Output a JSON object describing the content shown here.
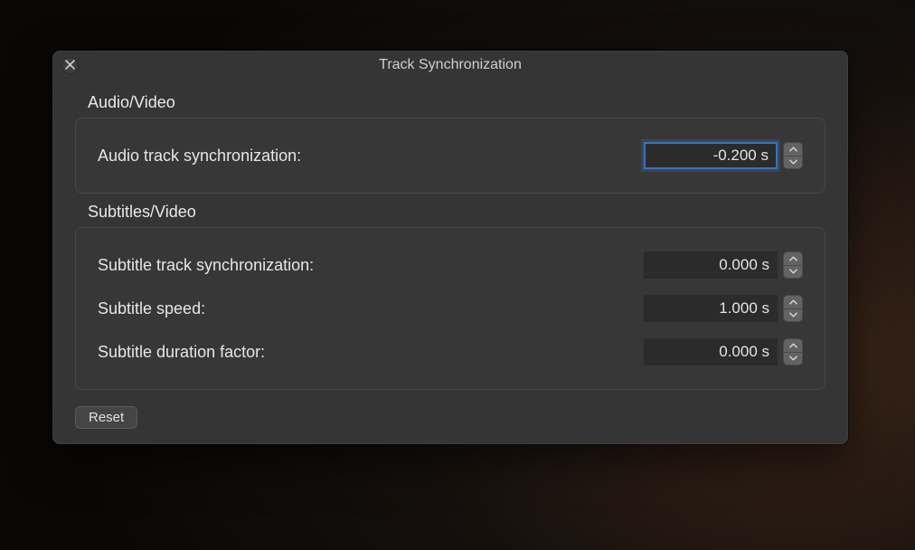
{
  "dialog": {
    "title": "Track Synchronization",
    "sections": {
      "audio_video": {
        "label": "Audio/Video",
        "rows": {
          "audio_sync": {
            "label": "Audio track synchronization:",
            "value": "-0.200 s",
            "focused": true
          }
        }
      },
      "subtitles_video": {
        "label": "Subtitles/Video",
        "rows": {
          "sub_sync": {
            "label": "Subtitle track synchronization:",
            "value": "0.000 s"
          },
          "sub_speed": {
            "label": "Subtitle speed:",
            "value": "1.000 s"
          },
          "sub_duration": {
            "label": "Subtitle duration factor:",
            "value": "0.000 s"
          }
        }
      }
    },
    "reset_label": "Reset"
  }
}
